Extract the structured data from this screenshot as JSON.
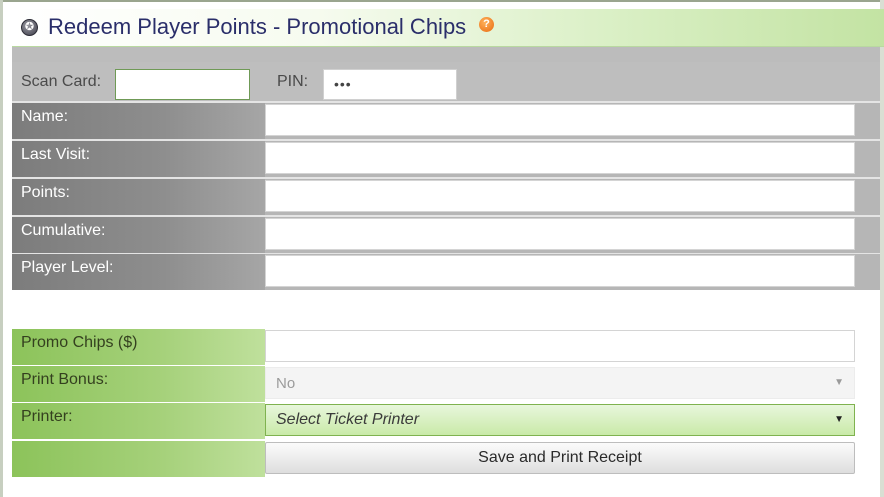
{
  "title": "Redeem Player Points - Promotional Chips",
  "icons": {
    "title": "app-logo-icon",
    "help": "help-icon"
  },
  "colors": {
    "title_text": "#2a2e6a",
    "green_label": "#8cc35a",
    "gray_label": "#7c7c7c"
  },
  "scan": {
    "label": "Scan Card:",
    "value": ""
  },
  "pin": {
    "label": "PIN:",
    "value": "•••"
  },
  "player_fields": [
    {
      "label": "Name:",
      "value": ""
    },
    {
      "label": "Last Visit:",
      "value": ""
    },
    {
      "label": "Points:",
      "value": ""
    },
    {
      "label": "Cumulative:",
      "value": ""
    },
    {
      "label": "Player Level:",
      "value": ""
    }
  ],
  "promo": {
    "label": "Promo Chips ($)",
    "value": ""
  },
  "print_bonus": {
    "label": "Print Bonus:",
    "selected": "No"
  },
  "printer": {
    "label": "Printer:",
    "selected": "Select Ticket Printer"
  },
  "save_button": "Save and Print Receipt"
}
